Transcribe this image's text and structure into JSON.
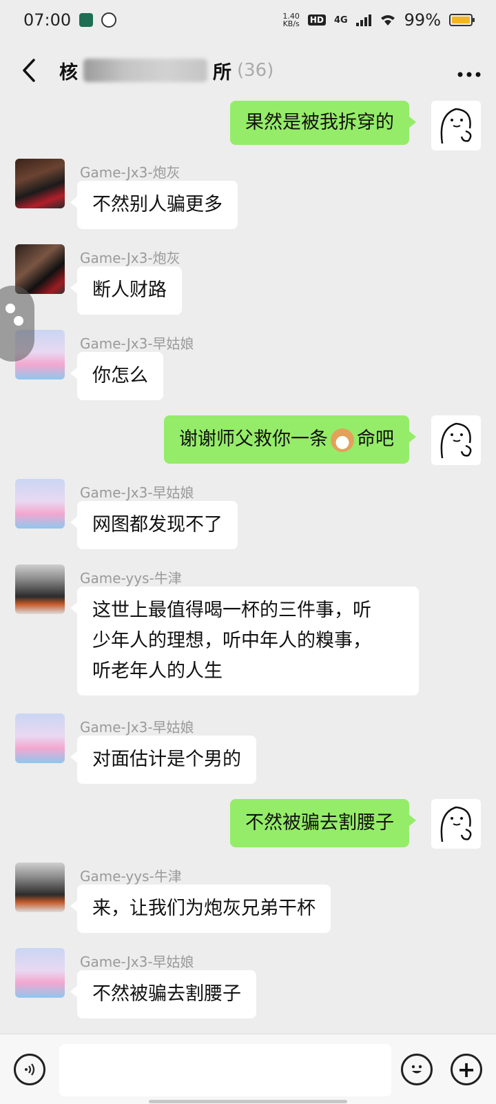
{
  "status_bar": {
    "time": "07:00",
    "net_speed_value": "1.40",
    "net_speed_unit": "KB/s",
    "hd_badge": "HD",
    "network": "4G",
    "battery_text": "99%",
    "battery_level": 0.99,
    "battery_color": "#f3b623"
  },
  "header": {
    "title_visible": "核",
    "title_suffix": "所",
    "member_count": "(36)",
    "more_icon": "more-dots-icon",
    "back_icon": "back-chevron-icon"
  },
  "colors": {
    "background": "#ededed",
    "outgoing_bubble": "#95ec69",
    "incoming_bubble": "#ffffff"
  },
  "messages": [
    {
      "direction": "out",
      "text": "果然是被我拆穿的"
    },
    {
      "direction": "in",
      "sender": "Game-Jx3-炮灰",
      "text": "不然别人骗更多"
    },
    {
      "direction": "in",
      "sender": "Game-Jx3-炮灰",
      "text": "断人财路"
    },
    {
      "direction": "in",
      "sender": "Game-Jx3-早姑娘",
      "text": "你怎么"
    },
    {
      "direction": "out",
      "text_before": "谢谢师父救你一条",
      "emoji": "dog-face-emoji",
      "text_after": "命吧"
    },
    {
      "direction": "in",
      "sender": "Game-Jx3-早姑娘",
      "text": "网图都发现不了"
    },
    {
      "direction": "in",
      "sender": "Game-yys-牛津",
      "lines": [
        "这世上最值得喝一杯的三件事，听",
        "少年人的理想，听中年人的糗事，",
        "听老年人的人生"
      ]
    },
    {
      "direction": "in",
      "sender": "Game-Jx3-早姑娘",
      "text": "对面估计是个男的"
    },
    {
      "direction": "out",
      "text": "不然被骗去割腰子"
    },
    {
      "direction": "in",
      "sender": "Game-yys-牛津",
      "text": "来，让我们为炮灰兄弟干杯"
    },
    {
      "direction": "in",
      "sender": "Game-Jx3-早姑娘",
      "text": "不然被骗去割腰子"
    }
  ],
  "input_bar": {
    "voice_icon": "voice-icon",
    "emoji_icon": "emoji-icon",
    "plus_icon": "plus-icon",
    "plus_glyph": "+"
  }
}
